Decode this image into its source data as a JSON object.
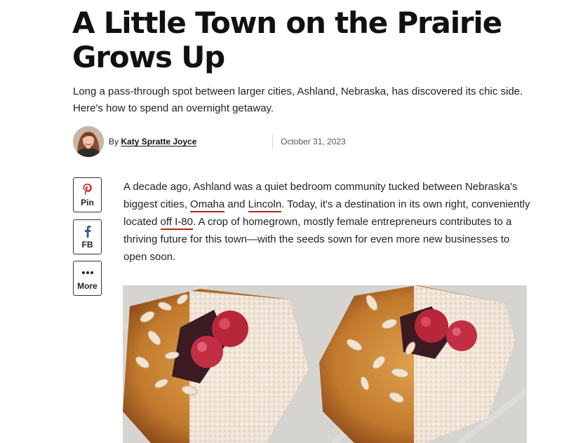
{
  "article": {
    "headline": "A Little Town on the Prairie Grows Up",
    "dek": "Long a pass-through spot between larger cities, Ashland, Nebraska, has discovered its chic side. Here's how to spend an overnight getaway.",
    "byline": {
      "prefix": "By",
      "author": "Katy Spratte Joyce",
      "date": "October 31, 2023"
    },
    "body": {
      "p1_start": "A decade ago, Ashland was a quiet bedroom community tucked between Nebraska's biggest cities, ",
      "link_omaha": "Omaha",
      "and": " and ",
      "link_lincoln": "Lincoln",
      "p1_mid": ". Today, it's a destination in its own right, conveniently located ",
      "link_i80": "off I-80",
      "p1_end": ". A crop of homegrown, mostly female entrepreneurs contributes to a thriving future for this town—with the seeds sown for even more new businesses to open soon."
    }
  },
  "share": {
    "pin_label": "Pin",
    "fb_label": "FB",
    "more_label": "More",
    "icons": {
      "pin": "pinterest-icon",
      "fb": "facebook-icon",
      "more": "more-dots-icon"
    }
  },
  "colors": {
    "link_underline": "#b4281b",
    "pinterest": "#c8232c",
    "facebook": "#3b5998"
  }
}
